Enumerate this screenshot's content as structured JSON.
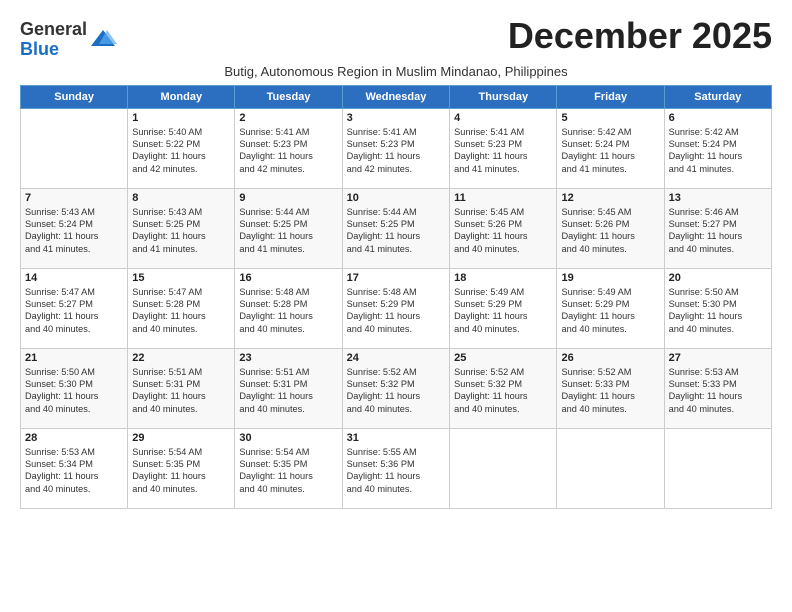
{
  "logo": {
    "general": "General",
    "blue": "Blue"
  },
  "header": {
    "month": "December 2025",
    "subtitle": "Butig, Autonomous Region in Muslim Mindanao, Philippines"
  },
  "days_of_week": [
    "Sunday",
    "Monday",
    "Tuesday",
    "Wednesday",
    "Thursday",
    "Friday",
    "Saturday"
  ],
  "weeks": [
    [
      {
        "day": "",
        "info": ""
      },
      {
        "day": "1",
        "info": "Sunrise: 5:40 AM\nSunset: 5:22 PM\nDaylight: 11 hours\nand 42 minutes."
      },
      {
        "day": "2",
        "info": "Sunrise: 5:41 AM\nSunset: 5:23 PM\nDaylight: 11 hours\nand 42 minutes."
      },
      {
        "day": "3",
        "info": "Sunrise: 5:41 AM\nSunset: 5:23 PM\nDaylight: 11 hours\nand 42 minutes."
      },
      {
        "day": "4",
        "info": "Sunrise: 5:41 AM\nSunset: 5:23 PM\nDaylight: 11 hours\nand 41 minutes."
      },
      {
        "day": "5",
        "info": "Sunrise: 5:42 AM\nSunset: 5:24 PM\nDaylight: 11 hours\nand 41 minutes."
      },
      {
        "day": "6",
        "info": "Sunrise: 5:42 AM\nSunset: 5:24 PM\nDaylight: 11 hours\nand 41 minutes."
      }
    ],
    [
      {
        "day": "7",
        "info": "Sunrise: 5:43 AM\nSunset: 5:24 PM\nDaylight: 11 hours\nand 41 minutes."
      },
      {
        "day": "8",
        "info": "Sunrise: 5:43 AM\nSunset: 5:25 PM\nDaylight: 11 hours\nand 41 minutes."
      },
      {
        "day": "9",
        "info": "Sunrise: 5:44 AM\nSunset: 5:25 PM\nDaylight: 11 hours\nand 41 minutes."
      },
      {
        "day": "10",
        "info": "Sunrise: 5:44 AM\nSunset: 5:25 PM\nDaylight: 11 hours\nand 41 minutes."
      },
      {
        "day": "11",
        "info": "Sunrise: 5:45 AM\nSunset: 5:26 PM\nDaylight: 11 hours\nand 40 minutes."
      },
      {
        "day": "12",
        "info": "Sunrise: 5:45 AM\nSunset: 5:26 PM\nDaylight: 11 hours\nand 40 minutes."
      },
      {
        "day": "13",
        "info": "Sunrise: 5:46 AM\nSunset: 5:27 PM\nDaylight: 11 hours\nand 40 minutes."
      }
    ],
    [
      {
        "day": "14",
        "info": "Sunrise: 5:47 AM\nSunset: 5:27 PM\nDaylight: 11 hours\nand 40 minutes."
      },
      {
        "day": "15",
        "info": "Sunrise: 5:47 AM\nSunset: 5:28 PM\nDaylight: 11 hours\nand 40 minutes."
      },
      {
        "day": "16",
        "info": "Sunrise: 5:48 AM\nSunset: 5:28 PM\nDaylight: 11 hours\nand 40 minutes."
      },
      {
        "day": "17",
        "info": "Sunrise: 5:48 AM\nSunset: 5:29 PM\nDaylight: 11 hours\nand 40 minutes."
      },
      {
        "day": "18",
        "info": "Sunrise: 5:49 AM\nSunset: 5:29 PM\nDaylight: 11 hours\nand 40 minutes."
      },
      {
        "day": "19",
        "info": "Sunrise: 5:49 AM\nSunset: 5:29 PM\nDaylight: 11 hours\nand 40 minutes."
      },
      {
        "day": "20",
        "info": "Sunrise: 5:50 AM\nSunset: 5:30 PM\nDaylight: 11 hours\nand 40 minutes."
      }
    ],
    [
      {
        "day": "21",
        "info": "Sunrise: 5:50 AM\nSunset: 5:30 PM\nDaylight: 11 hours\nand 40 minutes."
      },
      {
        "day": "22",
        "info": "Sunrise: 5:51 AM\nSunset: 5:31 PM\nDaylight: 11 hours\nand 40 minutes."
      },
      {
        "day": "23",
        "info": "Sunrise: 5:51 AM\nSunset: 5:31 PM\nDaylight: 11 hours\nand 40 minutes."
      },
      {
        "day": "24",
        "info": "Sunrise: 5:52 AM\nSunset: 5:32 PM\nDaylight: 11 hours\nand 40 minutes."
      },
      {
        "day": "25",
        "info": "Sunrise: 5:52 AM\nSunset: 5:32 PM\nDaylight: 11 hours\nand 40 minutes."
      },
      {
        "day": "26",
        "info": "Sunrise: 5:52 AM\nSunset: 5:33 PM\nDaylight: 11 hours\nand 40 minutes."
      },
      {
        "day": "27",
        "info": "Sunrise: 5:53 AM\nSunset: 5:33 PM\nDaylight: 11 hours\nand 40 minutes."
      }
    ],
    [
      {
        "day": "28",
        "info": "Sunrise: 5:53 AM\nSunset: 5:34 PM\nDaylight: 11 hours\nand 40 minutes."
      },
      {
        "day": "29",
        "info": "Sunrise: 5:54 AM\nSunset: 5:35 PM\nDaylight: 11 hours\nand 40 minutes."
      },
      {
        "day": "30",
        "info": "Sunrise: 5:54 AM\nSunset: 5:35 PM\nDaylight: 11 hours\nand 40 minutes."
      },
      {
        "day": "31",
        "info": "Sunrise: 5:55 AM\nSunset: 5:36 PM\nDaylight: 11 hours\nand 40 minutes."
      },
      {
        "day": "",
        "info": ""
      },
      {
        "day": "",
        "info": ""
      },
      {
        "day": "",
        "info": ""
      }
    ]
  ]
}
